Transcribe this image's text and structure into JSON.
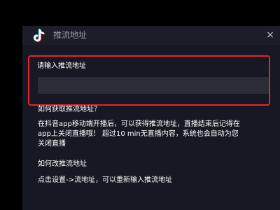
{
  "dialog": {
    "title": "推流地址",
    "logo_icon": "tiktok-note-icon",
    "close_icon": "close-icon",
    "close_glyph": "×",
    "accent_color": "#e8232a"
  },
  "input": {
    "label": "请输入推流地址",
    "value": "",
    "placeholder": ""
  },
  "help": {
    "q1": "如何获取推流地址？",
    "a1_line1": "在抖音app移动端开播后，可以获得推流地址，直播结束后记得在",
    "a1_line2": "app上关闭直播哦！ 超过10 min无直播内容，系统也会自动为您",
    "a1_line3": "关闭直播",
    "q2": "如何改推流地址",
    "a2": "点击设置->流地址，可以重新输入推流地址"
  }
}
